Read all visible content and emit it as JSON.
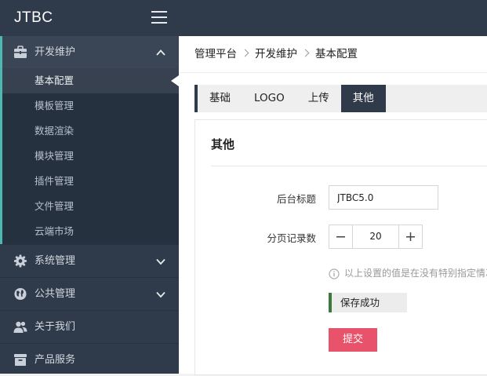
{
  "app": {
    "logo": "JTBC"
  },
  "sidebar": {
    "groups": [
      {
        "label": "开发维护",
        "expanded": true,
        "items": [
          "基本配置",
          "模板管理",
          "数据渲染",
          "模块管理",
          "插件管理",
          "文件管理",
          "云端市场"
        ],
        "active_item": "基本配置"
      },
      {
        "label": "系统管理",
        "expanded": false
      },
      {
        "label": "公共管理",
        "expanded": false
      },
      {
        "label": "关于我们"
      },
      {
        "label": "产品服务"
      }
    ]
  },
  "breadcrumb": [
    "管理平台",
    "开发维护",
    "基本配置"
  ],
  "tabs": [
    "基础",
    "LOGO",
    "上传",
    "其他"
  ],
  "active_tab": "其他",
  "panel": {
    "title": "其他",
    "fields": {
      "backend_title": {
        "label": "后台标题",
        "value": "JTBC5.0"
      },
      "page_size": {
        "label": "分页记录数",
        "value": "20"
      }
    },
    "hint": "以上设置的值是在没有特别指定情况下的默认值",
    "alert": "保存成功",
    "submit_label": "提交"
  },
  "colors": {
    "sidebar_bg": "#2f3a4a",
    "accent_teal": "#4db8b0",
    "submit": "#e8526a",
    "alert_bar": "#3c7a3c"
  }
}
